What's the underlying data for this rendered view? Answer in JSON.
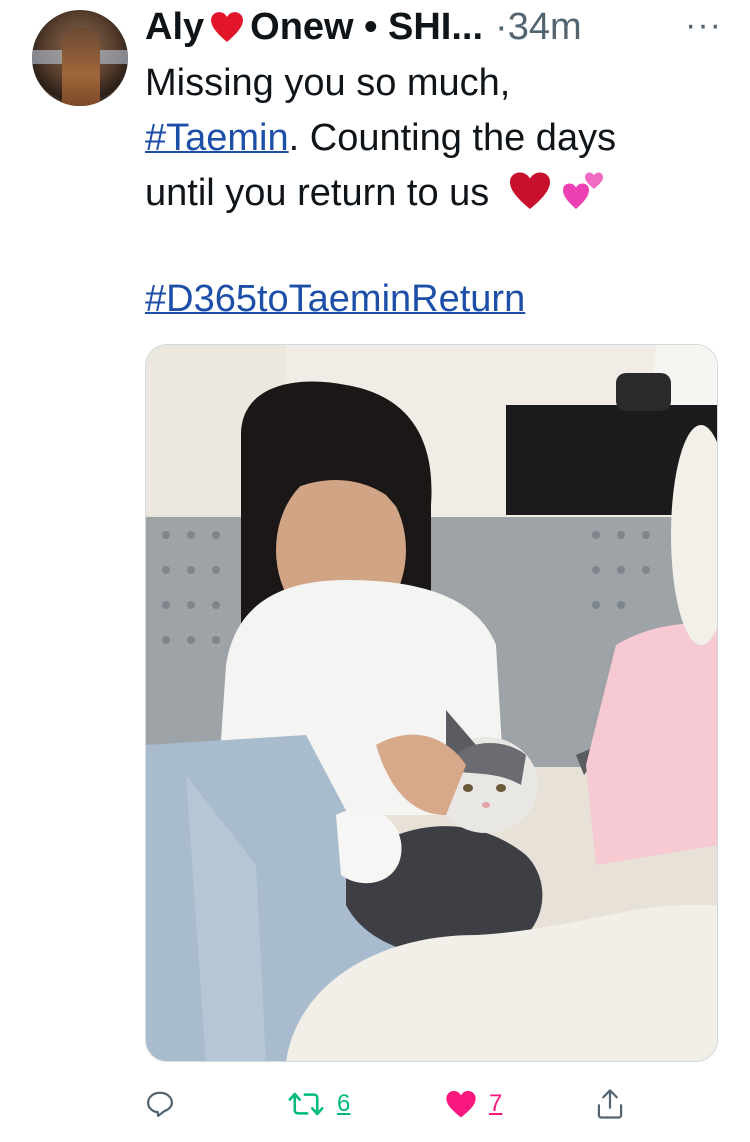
{
  "tweet": {
    "author_display": "Aly",
    "author_rest": "Onew • SHI...",
    "time": "·34m",
    "more": "···",
    "text_line1": "Missing you so much,",
    "hashtag1": "#Taemin",
    "text_after_hashtag": ". Counting the days",
    "text_line3": "until you return to us",
    "hashtag2": "#D365toTaeminReturn"
  },
  "actions": {
    "retweet_count": "6",
    "like_count": "7"
  },
  "colors": {
    "link": "#1d4fa8",
    "retweet": "#00ba7c",
    "like": "#f91880",
    "muted": "#536471"
  },
  "icons": [
    "reply-icon",
    "retweet-icon",
    "like-icon",
    "share-icon",
    "heart-emoji",
    "two-hearts-emoji",
    "more-icon"
  ]
}
